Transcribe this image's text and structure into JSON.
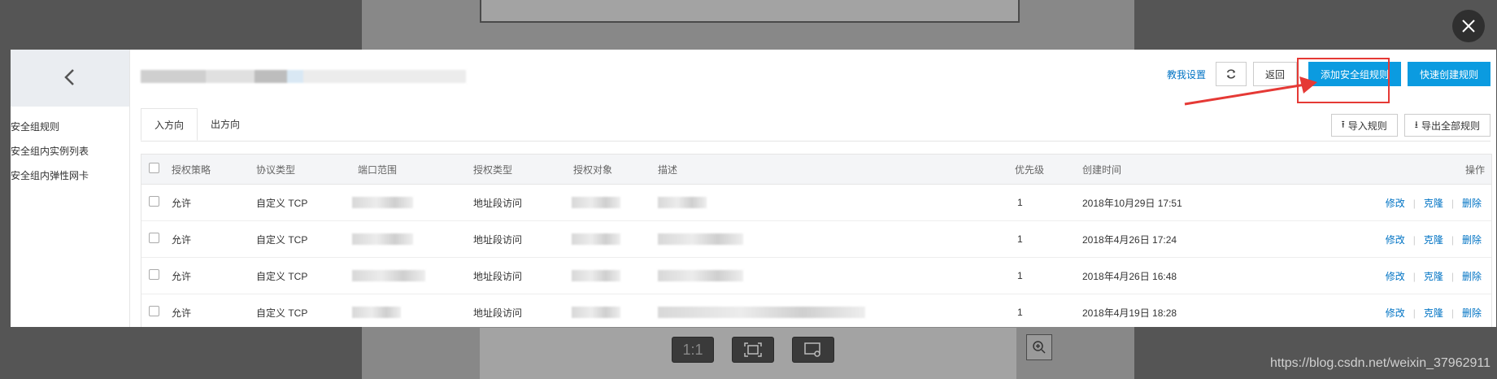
{
  "sidebar": {
    "items": [
      {
        "label": "安全组规则"
      },
      {
        "label": "安全组内实例列表"
      },
      {
        "label": "安全组内弹性网卡"
      }
    ]
  },
  "header": {
    "setting_link": "教我设置",
    "back_label": "返回",
    "add_rule_label": "添加安全组规则",
    "quick_create_label": "快速创建规则"
  },
  "tabs": [
    {
      "label": "入方向",
      "active": true
    },
    {
      "label": "出方向",
      "active": false
    }
  ],
  "tab_actions": {
    "import_label": "导入规则",
    "export_label": "导出全部规则"
  },
  "table": {
    "columns": [
      "授权策略",
      "协议类型",
      "端口范围",
      "授权类型",
      "授权对象",
      "描述",
      "优先级",
      "创建时间",
      "操作"
    ],
    "rows": [
      {
        "policy": "允许",
        "protocol": "自定义 TCP",
        "auth_type": "地址段访问",
        "priority": "1",
        "created": "2018年10月29日 17:51"
      },
      {
        "policy": "允许",
        "protocol": "自定义 TCP",
        "auth_type": "地址段访问",
        "priority": "1",
        "created": "2018年4月26日 17:24"
      },
      {
        "policy": "允许",
        "protocol": "自定义 TCP",
        "auth_type": "地址段访问",
        "priority": "1",
        "created": "2018年4月26日 16:48"
      },
      {
        "policy": "允许",
        "protocol": "自定义 TCP",
        "auth_type": "地址段访问",
        "priority": "1",
        "created": "2018年4月19日 18:28"
      }
    ],
    "ops": {
      "edit": "修改",
      "clone": "克隆",
      "delete": "删除"
    }
  },
  "viewer": {
    "one_to_one_label": "1:1"
  },
  "watermark": "https://blog.csdn.net/weixin_37962911",
  "colors": {
    "primary_button": "#0b9be0",
    "link": "#0073c4",
    "annotation_red": "#e53935"
  }
}
